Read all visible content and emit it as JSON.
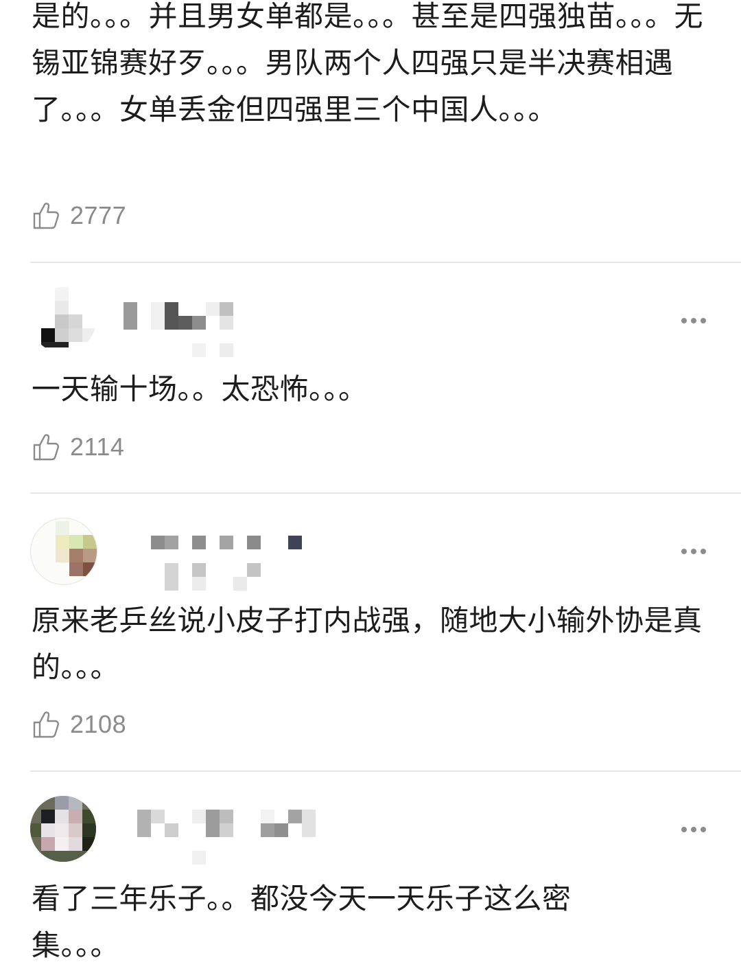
{
  "comments": [
    {
      "text": "是的。。。并且男女单都是。。。甚至是四强独苗。。。无锡亚锦赛好歹。。。男队两个人四强只是半决赛相遇了。。。女单丢金但四强里三个中国人。。。",
      "likes": "2777"
    },
    {
      "text": "一天输十场。。太恐怖。。。",
      "likes": "2114"
    },
    {
      "text": "原来老乒丝说小皮子打内战强，随地大小输外协是真的。。。",
      "likes": "2108"
    },
    {
      "text": "看了三年乐子。。都没今天一天乐子这么密集。。。",
      "likes": ""
    }
  ],
  "icons": {
    "like": "thumbs-up-icon",
    "more": "more-dots-icon"
  },
  "colors": {
    "text": "#1c1c1c",
    "muted": "#8a8a8a",
    "divider": "#e6e6e6"
  }
}
